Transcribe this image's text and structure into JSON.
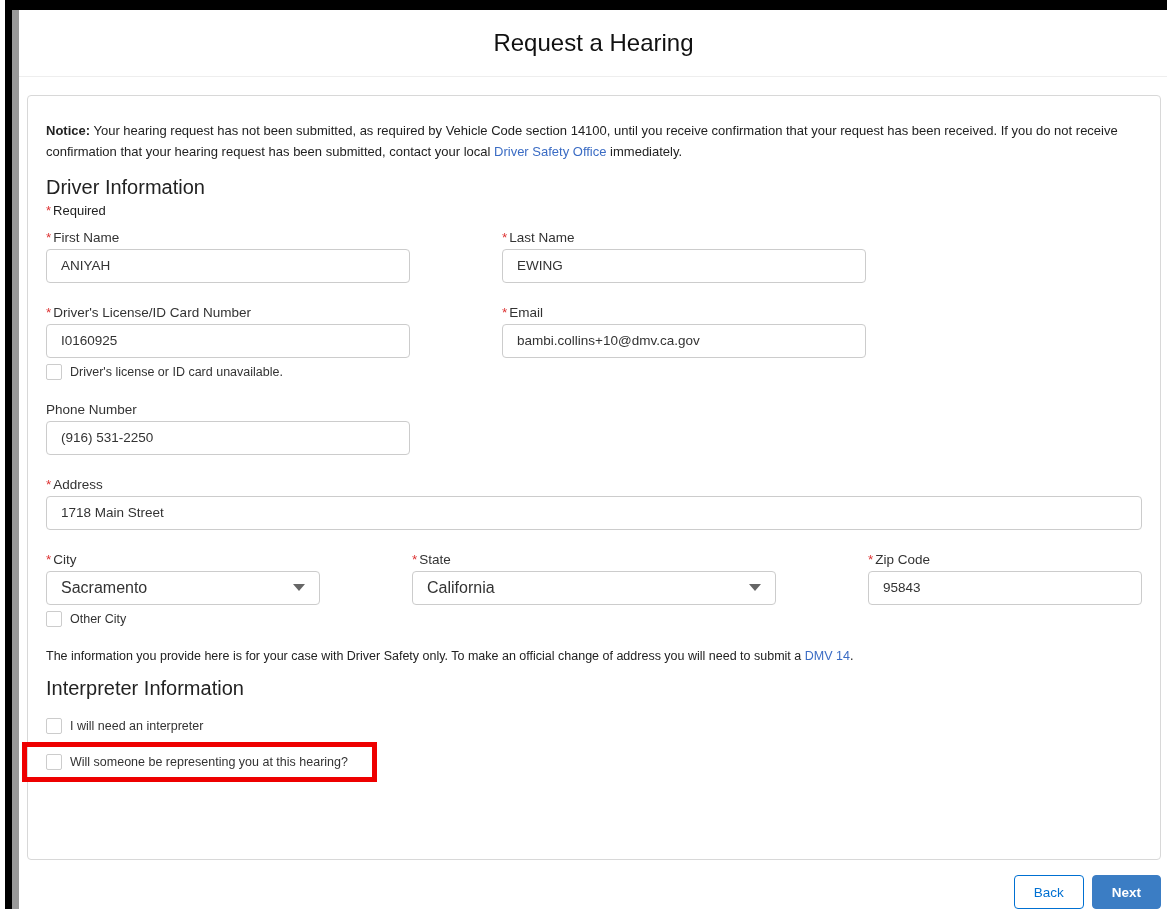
{
  "title": "Request a Hearing",
  "required_mark": "*",
  "notice": {
    "lead": "Notice:",
    "text": " Your hearing request has not been submitted, as required by Vehicle Code section 14100, until you receive confirmation that your request has been received. If you do not receive confirmation that your hearing request has been submitted, contact your local ",
    "link": "Driver Safety Office",
    "tail": " immediately."
  },
  "driver": {
    "heading": "Driver Information",
    "required_note": "Required",
    "rows": [
      [
        {
          "kind": "text",
          "label": "First Name",
          "required": true,
          "value": "ANIYAH"
        },
        {
          "kind": "text",
          "label": "Last Name",
          "required": true,
          "value": "EWING"
        }
      ],
      [
        {
          "kind": "text",
          "label": "Driver's License/ID Card Number",
          "required": true,
          "value": "I0160925",
          "checkbox": {
            "label": "Driver's license or ID card unavailable.",
            "checked": false
          }
        },
        {
          "kind": "text",
          "label": "Email",
          "required": true,
          "value": "bambi.collins+10@dmv.ca.gov"
        }
      ],
      [
        {
          "kind": "text",
          "label": "Phone Number",
          "required": false,
          "value": "(916) 531-2250"
        }
      ],
      [
        {
          "kind": "wide",
          "label": "Address",
          "required": true,
          "value": "1718 Main Street"
        }
      ],
      [
        {
          "kind": "select",
          "label": "City",
          "required": true,
          "value": "Sacramento",
          "checkbox": {
            "label": "Other City",
            "checked": false
          }
        },
        {
          "kind": "select",
          "label": "State",
          "required": true,
          "value": "California"
        },
        {
          "kind": "text",
          "label": "Zip Code",
          "required": true,
          "value": "95843"
        }
      ]
    ],
    "note": {
      "text": "The information you provide here is for your case with Driver Safety only. To make an official change of address you will need to submit a ",
      "link": "DMV 14",
      "tail": "."
    }
  },
  "interpreter": {
    "heading": "Interpreter Information",
    "checkboxes": [
      {
        "label": "I will need an interpreter",
        "checked": false,
        "highlighted": false
      },
      {
        "label": "Will someone be representing you at this hearing?",
        "checked": false,
        "highlighted": true
      }
    ]
  },
  "buttons": [
    {
      "label": "Back",
      "kind": "secondary"
    },
    {
      "label": "Next",
      "kind": "primary"
    }
  ]
}
